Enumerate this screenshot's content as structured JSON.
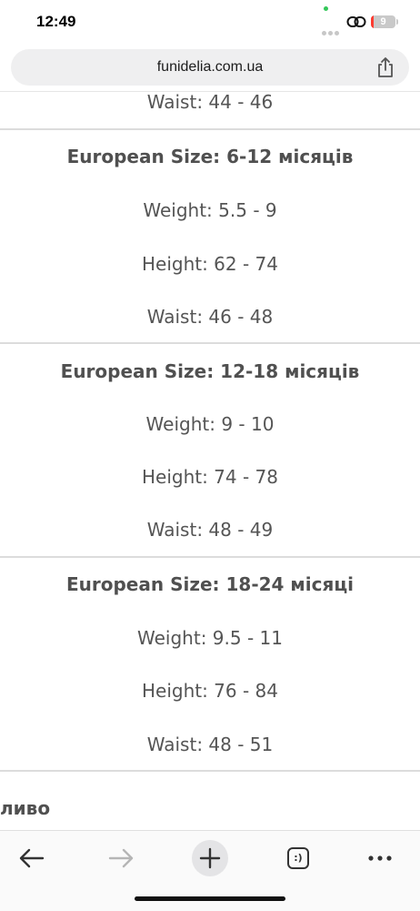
{
  "status_bar": {
    "time": "12:49",
    "battery_level": "9"
  },
  "browser": {
    "url": "funidelia.com.ua"
  },
  "size_chart": {
    "top_partial_row": "Waist: 44 - 46",
    "sections": [
      {
        "heading": "European Size: 6-12 місяців",
        "weight": "Weight: 5.5 - 9",
        "height": "Height: 62 - 74",
        "waist": "Waist: 46 - 48"
      },
      {
        "heading": "European Size: 12-18 місяців",
        "weight": "Weight: 9 - 10",
        "height": "Height: 74 - 78",
        "waist": "Waist: 48 - 49"
      },
      {
        "heading": "European Size: 18-24 місяці",
        "weight": "Weight: 9.5 - 11",
        "height": "Height: 76 - 84",
        "waist": "Waist: 48 - 51"
      }
    ],
    "bottom_partial_text": "ливо"
  },
  "toolbar": {
    "back_icon": "arrow-left-icon",
    "forward_icon": "arrow-right-icon",
    "new_tab_icon": "plus-icon",
    "tabs_icon": "tabs-icon",
    "menu_icon": "more-icon",
    "tabs_label": ":)"
  }
}
